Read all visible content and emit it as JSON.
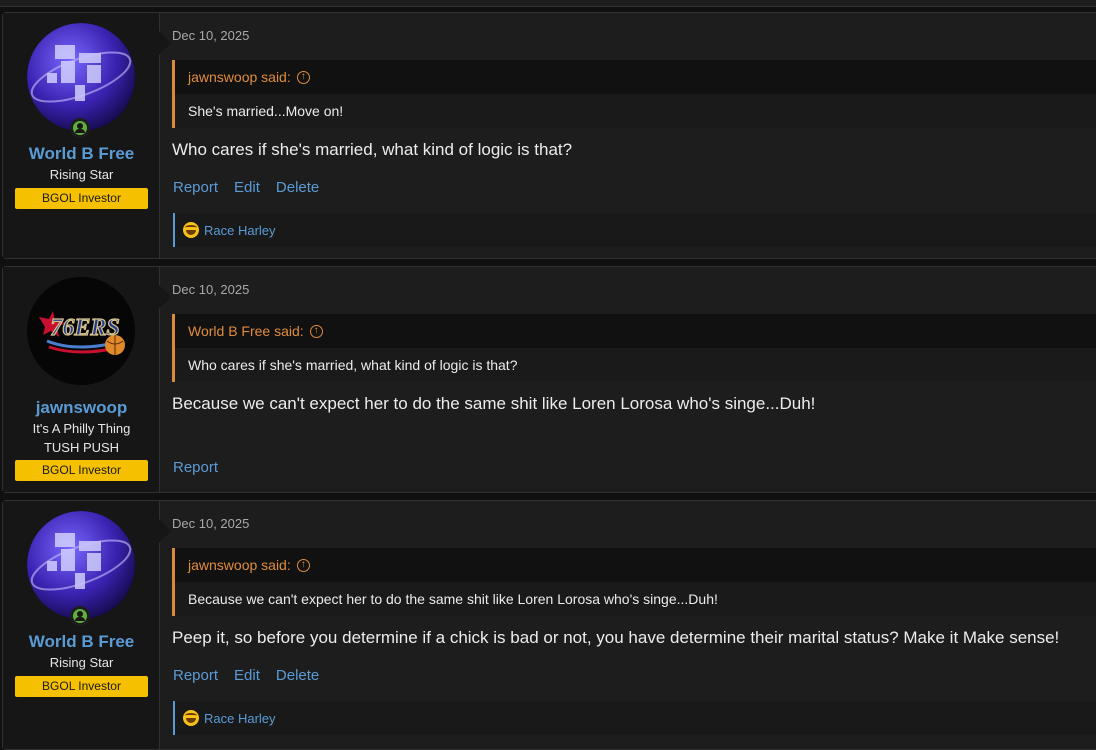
{
  "posts": [
    {
      "username": "World B Free",
      "user_titles": [
        "Rising Star"
      ],
      "banner": "BGOL Investor",
      "avatar": "globe-avatar",
      "online": true,
      "date": "Dec 10, 2025",
      "quote": {
        "author_said": "jawnswoop said:",
        "text": "She's married...Move on!"
      },
      "message": "Who cares if she's married, what kind of logic is that?",
      "actions": [
        "Report",
        "Edit",
        "Delete"
      ],
      "reaction": {
        "emoji": "laughing-emoji-icon",
        "users": "Race Harley"
      }
    },
    {
      "username": "jawnswoop",
      "user_titles": [
        "It's A Philly Thing",
        "TUSH PUSH"
      ],
      "banner": "BGOL Investor",
      "avatar": "76ers-logo-avatar",
      "online": false,
      "date": "Dec 10, 2025",
      "quote": {
        "author_said": "World B Free said:",
        "text": "Who cares if she's married, what kind of logic is that?"
      },
      "message": "Because we can't expect her to do the same shit like Loren Lorosa who's singe...Duh!",
      "actions": [
        "Report"
      ]
    },
    {
      "username": "World B Free",
      "user_titles": [
        "Rising Star"
      ],
      "banner": "BGOL Investor",
      "avatar": "globe-avatar",
      "online": true,
      "date": "Dec 10, 2025",
      "quote": {
        "author_said": "jawnswoop said:",
        "text": "Because we can't expect her to do the same shit like Loren Lorosa who's singe...Duh!"
      },
      "message": "Peep it, so before you determine if a chick is bad or not, you have determine their marital status? Make it Make sense!",
      "actions": [
        "Report",
        "Edit",
        "Delete"
      ],
      "reaction": {
        "emoji": "laughing-emoji-icon",
        "users": "Race Harley"
      }
    }
  ],
  "avatar_text": {
    "logo": "76ERS"
  },
  "colors": {
    "username": "#5b9bd5",
    "quote_accent": "#e08c3e",
    "banner": "#f5c000",
    "online": "#5fb03e"
  }
}
